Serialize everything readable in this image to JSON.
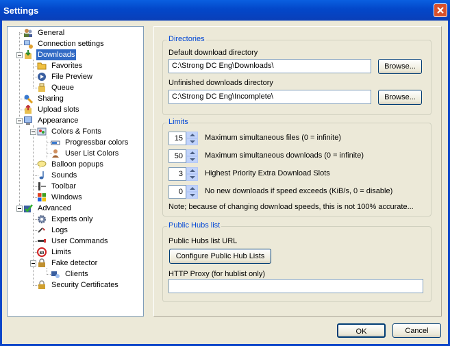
{
  "window": {
    "title": "Settings"
  },
  "tree": {
    "items": [
      {
        "label": "General",
        "icon": "users-icon"
      },
      {
        "label": "Connection settings",
        "icon": "network-icon"
      },
      {
        "label": "Downloads",
        "icon": "download-icon",
        "selected": true
      },
      {
        "label": "Favorites",
        "icon": "folder-icon"
      },
      {
        "label": "File Preview",
        "icon": "media-play-icon"
      },
      {
        "label": "Queue",
        "icon": "queue-icon"
      },
      {
        "label": "Sharing",
        "icon": "sharing-icon"
      },
      {
        "label": "Upload slots",
        "icon": "upload-icon"
      },
      {
        "label": "Appearance",
        "icon": "monitor-icon"
      },
      {
        "label": "Colors & Fonts",
        "icon": "palette-icon"
      },
      {
        "label": "Progressbar colors",
        "icon": "progressbar-icon"
      },
      {
        "label": "User List Colors",
        "icon": "user-icon"
      },
      {
        "label": "Balloon popups",
        "icon": "balloon-icon"
      },
      {
        "label": "Sounds",
        "icon": "music-note-icon"
      },
      {
        "label": "Toolbar",
        "icon": "toolbar-icon"
      },
      {
        "label": "Windows",
        "icon": "windows-logo-icon"
      },
      {
        "label": "Advanced",
        "icon": "checkmark-icon"
      },
      {
        "label": "Experts only",
        "icon": "gear-icon"
      },
      {
        "label": "Logs",
        "icon": "logs-icon"
      },
      {
        "label": "User Commands",
        "icon": "commands-icon"
      },
      {
        "label": "Limits",
        "icon": "speed-limit-icon"
      },
      {
        "label": "Fake detector",
        "icon": "lock-icon"
      },
      {
        "label": "Clients",
        "icon": "clients-icon"
      },
      {
        "label": "Security Certificates",
        "icon": "padlock-icon"
      }
    ]
  },
  "directories": {
    "title": "Directories",
    "default_label": "Default download directory",
    "default_value": "C:\\Strong DC Eng\\Downloads\\",
    "unfinished_label": "Unfinished downloads directory",
    "unfinished_value": "C:\\Strong DC Eng\\Incomplete\\",
    "browse_label": "Browse..."
  },
  "limits": {
    "title": "Limits",
    "rows": [
      {
        "value": "15",
        "label": "Maximum simultaneous files (0 = infinite)"
      },
      {
        "value": "50",
        "label": "Maximum simultaneous downloads (0 = infinite)"
      },
      {
        "value": "3",
        "label": "Highest Priority Extra Download Slots"
      },
      {
        "value": "0",
        "label": "No new downloads if speed exceeds (KiB/s, 0 = disable)"
      }
    ],
    "note": "Note; because of changing download speeds, this is not 100% accurate..."
  },
  "hubs": {
    "title": "Public Hubs list",
    "url_label": "Public Hubs list URL",
    "configure_label": "Configure Public Hub Lists",
    "proxy_label": "HTTP Proxy (for hublist only)",
    "proxy_value": ""
  },
  "buttons": {
    "ok": "OK",
    "cancel": "Cancel"
  },
  "colors": {
    "title_bar": "#0a5fe0",
    "selection": "#316ac5",
    "group_title": "#0046d5",
    "dialog_bg": "#ece9d8"
  }
}
